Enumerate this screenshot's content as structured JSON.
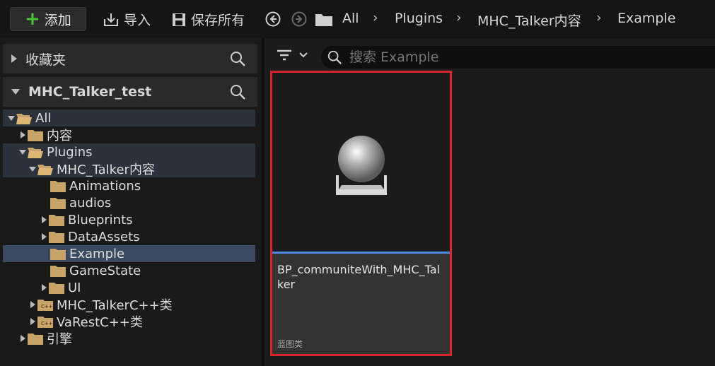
{
  "toolbar": {
    "add_label": "添加",
    "import_label": "导入",
    "save_all_label": "保存所有",
    "breadcrumbs": [
      "All",
      "Plugins",
      "MHC_Talker内容",
      "Example"
    ]
  },
  "sidebar": {
    "favorites_label": "收藏夹",
    "project_label": "MHC_Talker_test",
    "tree": [
      {
        "label": "All",
        "expanded": true,
        "selected": false
      },
      {
        "label": "内容",
        "expanded": false
      },
      {
        "label": "Plugins",
        "expanded": true
      },
      {
        "label": "MHC_Talker内容",
        "expanded": true
      },
      {
        "label": "Animations"
      },
      {
        "label": "audios"
      },
      {
        "label": "Blueprints",
        "expanded": false
      },
      {
        "label": "DataAssets",
        "expanded": false
      },
      {
        "label": "Example",
        "selected": true
      },
      {
        "label": "GameState"
      },
      {
        "label": "UI",
        "expanded": false
      },
      {
        "label": "MHC_TalkerC++类",
        "expanded": false
      },
      {
        "label": "VaRestC++类",
        "expanded": false
      },
      {
        "label": "引擎",
        "expanded": false
      }
    ]
  },
  "content": {
    "search_placeholder": "搜索 Example",
    "assets": [
      {
        "name": "BP_communiteWith_MHC_Talker",
        "type": "蓝图类"
      }
    ]
  },
  "colors": {
    "accent_green": "#4fc23b",
    "selection_border": "#d9262b",
    "asset_bar": "#4a8be0",
    "folder": "#c9a468"
  }
}
